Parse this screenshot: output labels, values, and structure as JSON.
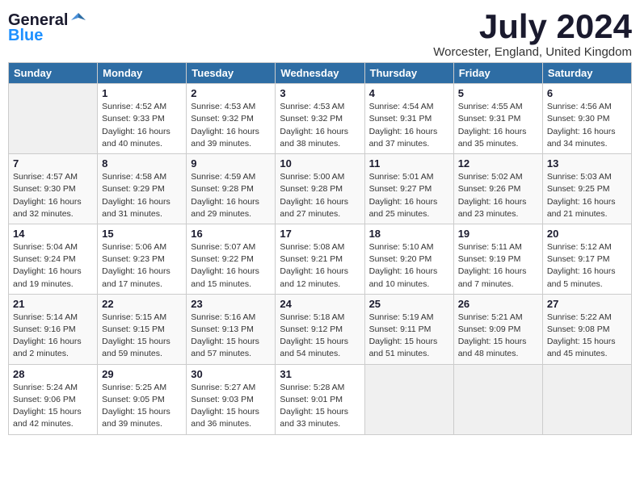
{
  "logo": {
    "general": "General",
    "blue": "Blue"
  },
  "title": "July 2024",
  "location": "Worcester, England, United Kingdom",
  "days_of_week": [
    "Sunday",
    "Monday",
    "Tuesday",
    "Wednesday",
    "Thursday",
    "Friday",
    "Saturday"
  ],
  "weeks": [
    [
      {
        "day": "",
        "empty": true
      },
      {
        "day": "1",
        "sunrise": "Sunrise: 4:52 AM",
        "sunset": "Sunset: 9:33 PM",
        "daylight": "Daylight: 16 hours and 40 minutes."
      },
      {
        "day": "2",
        "sunrise": "Sunrise: 4:53 AM",
        "sunset": "Sunset: 9:32 PM",
        "daylight": "Daylight: 16 hours and 39 minutes."
      },
      {
        "day": "3",
        "sunrise": "Sunrise: 4:53 AM",
        "sunset": "Sunset: 9:32 PM",
        "daylight": "Daylight: 16 hours and 38 minutes."
      },
      {
        "day": "4",
        "sunrise": "Sunrise: 4:54 AM",
        "sunset": "Sunset: 9:31 PM",
        "daylight": "Daylight: 16 hours and 37 minutes."
      },
      {
        "day": "5",
        "sunrise": "Sunrise: 4:55 AM",
        "sunset": "Sunset: 9:31 PM",
        "daylight": "Daylight: 16 hours and 35 minutes."
      },
      {
        "day": "6",
        "sunrise": "Sunrise: 4:56 AM",
        "sunset": "Sunset: 9:30 PM",
        "daylight": "Daylight: 16 hours and 34 minutes."
      }
    ],
    [
      {
        "day": "7",
        "sunrise": "Sunrise: 4:57 AM",
        "sunset": "Sunset: 9:30 PM",
        "daylight": "Daylight: 16 hours and 32 minutes."
      },
      {
        "day": "8",
        "sunrise": "Sunrise: 4:58 AM",
        "sunset": "Sunset: 9:29 PM",
        "daylight": "Daylight: 16 hours and 31 minutes."
      },
      {
        "day": "9",
        "sunrise": "Sunrise: 4:59 AM",
        "sunset": "Sunset: 9:28 PM",
        "daylight": "Daylight: 16 hours and 29 minutes."
      },
      {
        "day": "10",
        "sunrise": "Sunrise: 5:00 AM",
        "sunset": "Sunset: 9:28 PM",
        "daylight": "Daylight: 16 hours and 27 minutes."
      },
      {
        "day": "11",
        "sunrise": "Sunrise: 5:01 AM",
        "sunset": "Sunset: 9:27 PM",
        "daylight": "Daylight: 16 hours and 25 minutes."
      },
      {
        "day": "12",
        "sunrise": "Sunrise: 5:02 AM",
        "sunset": "Sunset: 9:26 PM",
        "daylight": "Daylight: 16 hours and 23 minutes."
      },
      {
        "day": "13",
        "sunrise": "Sunrise: 5:03 AM",
        "sunset": "Sunset: 9:25 PM",
        "daylight": "Daylight: 16 hours and 21 minutes."
      }
    ],
    [
      {
        "day": "14",
        "sunrise": "Sunrise: 5:04 AM",
        "sunset": "Sunset: 9:24 PM",
        "daylight": "Daylight: 16 hours and 19 minutes."
      },
      {
        "day": "15",
        "sunrise": "Sunrise: 5:06 AM",
        "sunset": "Sunset: 9:23 PM",
        "daylight": "Daylight: 16 hours and 17 minutes."
      },
      {
        "day": "16",
        "sunrise": "Sunrise: 5:07 AM",
        "sunset": "Sunset: 9:22 PM",
        "daylight": "Daylight: 16 hours and 15 minutes."
      },
      {
        "day": "17",
        "sunrise": "Sunrise: 5:08 AM",
        "sunset": "Sunset: 9:21 PM",
        "daylight": "Daylight: 16 hours and 12 minutes."
      },
      {
        "day": "18",
        "sunrise": "Sunrise: 5:10 AM",
        "sunset": "Sunset: 9:20 PM",
        "daylight": "Daylight: 16 hours and 10 minutes."
      },
      {
        "day": "19",
        "sunrise": "Sunrise: 5:11 AM",
        "sunset": "Sunset: 9:19 PM",
        "daylight": "Daylight: 16 hours and 7 minutes."
      },
      {
        "day": "20",
        "sunrise": "Sunrise: 5:12 AM",
        "sunset": "Sunset: 9:17 PM",
        "daylight": "Daylight: 16 hours and 5 minutes."
      }
    ],
    [
      {
        "day": "21",
        "sunrise": "Sunrise: 5:14 AM",
        "sunset": "Sunset: 9:16 PM",
        "daylight": "Daylight: 16 hours and 2 minutes."
      },
      {
        "day": "22",
        "sunrise": "Sunrise: 5:15 AM",
        "sunset": "Sunset: 9:15 PM",
        "daylight": "Daylight: 15 hours and 59 minutes."
      },
      {
        "day": "23",
        "sunrise": "Sunrise: 5:16 AM",
        "sunset": "Sunset: 9:13 PM",
        "daylight": "Daylight: 15 hours and 57 minutes."
      },
      {
        "day": "24",
        "sunrise": "Sunrise: 5:18 AM",
        "sunset": "Sunset: 9:12 PM",
        "daylight": "Daylight: 15 hours and 54 minutes."
      },
      {
        "day": "25",
        "sunrise": "Sunrise: 5:19 AM",
        "sunset": "Sunset: 9:11 PM",
        "daylight": "Daylight: 15 hours and 51 minutes."
      },
      {
        "day": "26",
        "sunrise": "Sunrise: 5:21 AM",
        "sunset": "Sunset: 9:09 PM",
        "daylight": "Daylight: 15 hours and 48 minutes."
      },
      {
        "day": "27",
        "sunrise": "Sunrise: 5:22 AM",
        "sunset": "Sunset: 9:08 PM",
        "daylight": "Daylight: 15 hours and 45 minutes."
      }
    ],
    [
      {
        "day": "28",
        "sunrise": "Sunrise: 5:24 AM",
        "sunset": "Sunset: 9:06 PM",
        "daylight": "Daylight: 15 hours and 42 minutes."
      },
      {
        "day": "29",
        "sunrise": "Sunrise: 5:25 AM",
        "sunset": "Sunset: 9:05 PM",
        "daylight": "Daylight: 15 hours and 39 minutes."
      },
      {
        "day": "30",
        "sunrise": "Sunrise: 5:27 AM",
        "sunset": "Sunset: 9:03 PM",
        "daylight": "Daylight: 15 hours and 36 minutes."
      },
      {
        "day": "31",
        "sunrise": "Sunrise: 5:28 AM",
        "sunset": "Sunset: 9:01 PM",
        "daylight": "Daylight: 15 hours and 33 minutes."
      },
      {
        "day": "",
        "empty": true
      },
      {
        "day": "",
        "empty": true
      },
      {
        "day": "",
        "empty": true
      }
    ]
  ]
}
